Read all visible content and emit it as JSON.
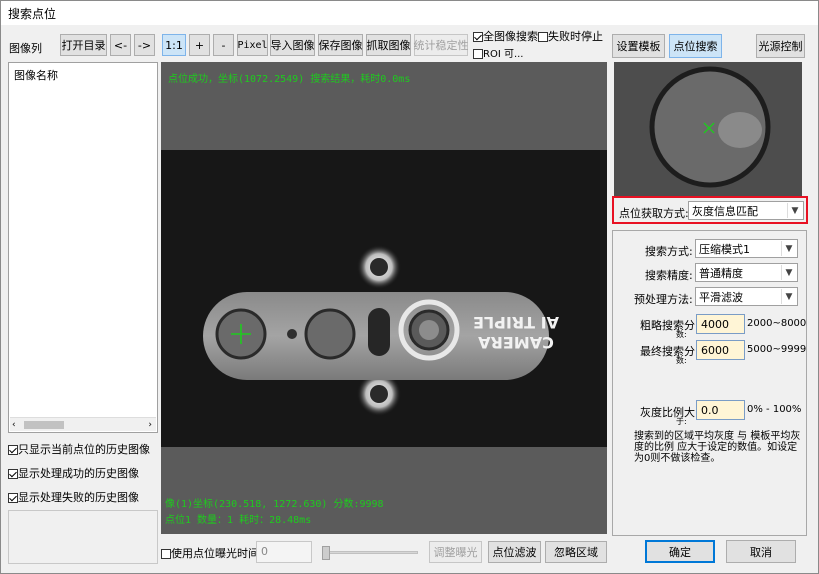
{
  "window": {
    "title": "搜索点位"
  },
  "left_panel": {
    "label": "图像列",
    "list_header": "图像名称",
    "checkboxes": [
      {
        "label": "只显示当前点位的历史图像",
        "checked": true
      },
      {
        "label": "显示处理成功的历史图像",
        "checked": true
      },
      {
        "label": "显示处理失败的历史图像",
        "checked": true
      }
    ]
  },
  "toolbar": {
    "open_dir": "打开目录",
    "prev": "<-",
    "next": "->",
    "zoom_1_1": "1:1",
    "zoom_in": "+",
    "zoom_out": "-",
    "pixel": "Pixel",
    "import": "导入图像",
    "save": "保存图像",
    "capture": "抓取图像",
    "stability": "统计稳定性",
    "all_search": {
      "label": "全图像搜索",
      "checked": true
    },
    "stop_on_fail": {
      "label": "失败时停止",
      "checked": false
    },
    "roi": {
      "label": "ROI 可...",
      "checked": false
    }
  },
  "viewer": {
    "top_text": "点位成功，坐标(1072.2549) 搜索结果，耗时0.0ms",
    "bottom_text1": "像(1)坐标(230.518, 1272.630) 分数:9998",
    "bottom_text2": "点位1 数量：1 耗时：28.48ms",
    "label_line1": "CAMERA",
    "label_line2": "AI TRIPLE"
  },
  "right_panel": {
    "template_btn": "设置模板",
    "search_btn": "点位搜索",
    "light_btn": "光源控制",
    "acquire_label": "点位获取方式:",
    "acquire_value": "灰度信息匹配",
    "search_mode_label": "搜索方式:",
    "search_mode_value": "压缩模式1",
    "precision_label": "搜索精度:",
    "precision_value": "普通精度",
    "preprocess_label": "预处理方法:",
    "preprocess_value": "平滑滤波",
    "coarse_label": "粗略搜索分",
    "coarse_sub": "数:",
    "coarse_value": "4000",
    "coarse_range": "2000~8000",
    "final_label": "最终搜索分",
    "final_sub": "数:",
    "final_value": "6000",
    "final_range": "5000~9999",
    "gray_label": "灰度比例大",
    "gray_sub": "于:",
    "gray_value": "0.0",
    "gray_range": "0% - 100%",
    "description": "搜索到的区域平均灰度 与 模板平均灰度的比例 应大于设定的数值。如设定为0则不做该检查。"
  },
  "bottom_bar": {
    "exposure": {
      "label": "使用点位曝光时间",
      "checked": false
    },
    "exposure_value": "0",
    "adjust_exposure": "调整曝光",
    "filter": "点位滤波",
    "ignore": "忽略区域",
    "ok": "确定",
    "cancel": "取消"
  },
  "colors": {
    "overlay_green": "#1ecb1e",
    "highlight_red": "#e81123",
    "accent_blue": "#0078d7"
  }
}
